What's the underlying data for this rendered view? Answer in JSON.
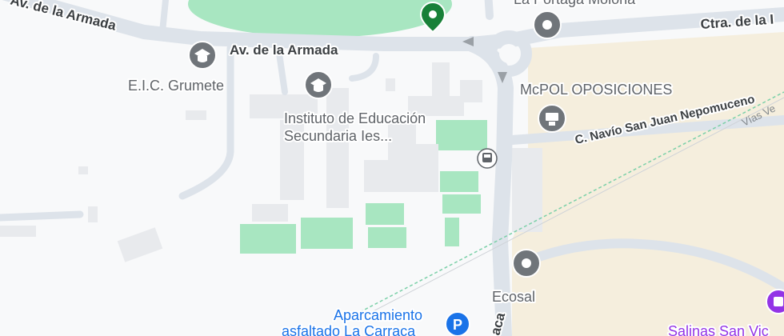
{
  "roads": {
    "armada_top": "Av. de la Armada",
    "armada_main": "Av. de la Armada",
    "ctra": "Ctra. de la I",
    "navio": "C. Navío San Juan Nepomuceno",
    "carraca_fragment": "aca",
    "railway": "Vías Ve"
  },
  "pois": {
    "eic": "E.I.C. Grumete",
    "instituto_line1": "Instituto de Educación",
    "instituto_line2": "Secundaria Ies...",
    "mcpol": "McPOL OPOSICIONES",
    "ecosal": "Ecosal",
    "aparcamiento_line1": "Aparcamiento",
    "aparcamiento_line2": "asfaltado La Carraca",
    "salinas": "Salinas San Vic",
    "portaga": "La Portaga Molona"
  },
  "icons": {
    "eic": "school-icon",
    "instituto": "school-icon",
    "mcpol": "training-icon",
    "ecosal": "place-icon",
    "portaga": "place-icon",
    "green_pin": "place-pin-icon",
    "bus": "bus-stop-icon",
    "parking": "parking-icon",
    "salinas": "attraction-icon"
  },
  "colors": {
    "background": "#f8f9fa",
    "road": "#dde3ea",
    "building": "#e8eaed",
    "sports_field": "#a8e6c1",
    "sand": "#f5eedd",
    "poi_gray": "#70757a",
    "pin_green": "#188038",
    "parking_blue": "#1a73e8",
    "salinas_purple": "#9334e6"
  }
}
